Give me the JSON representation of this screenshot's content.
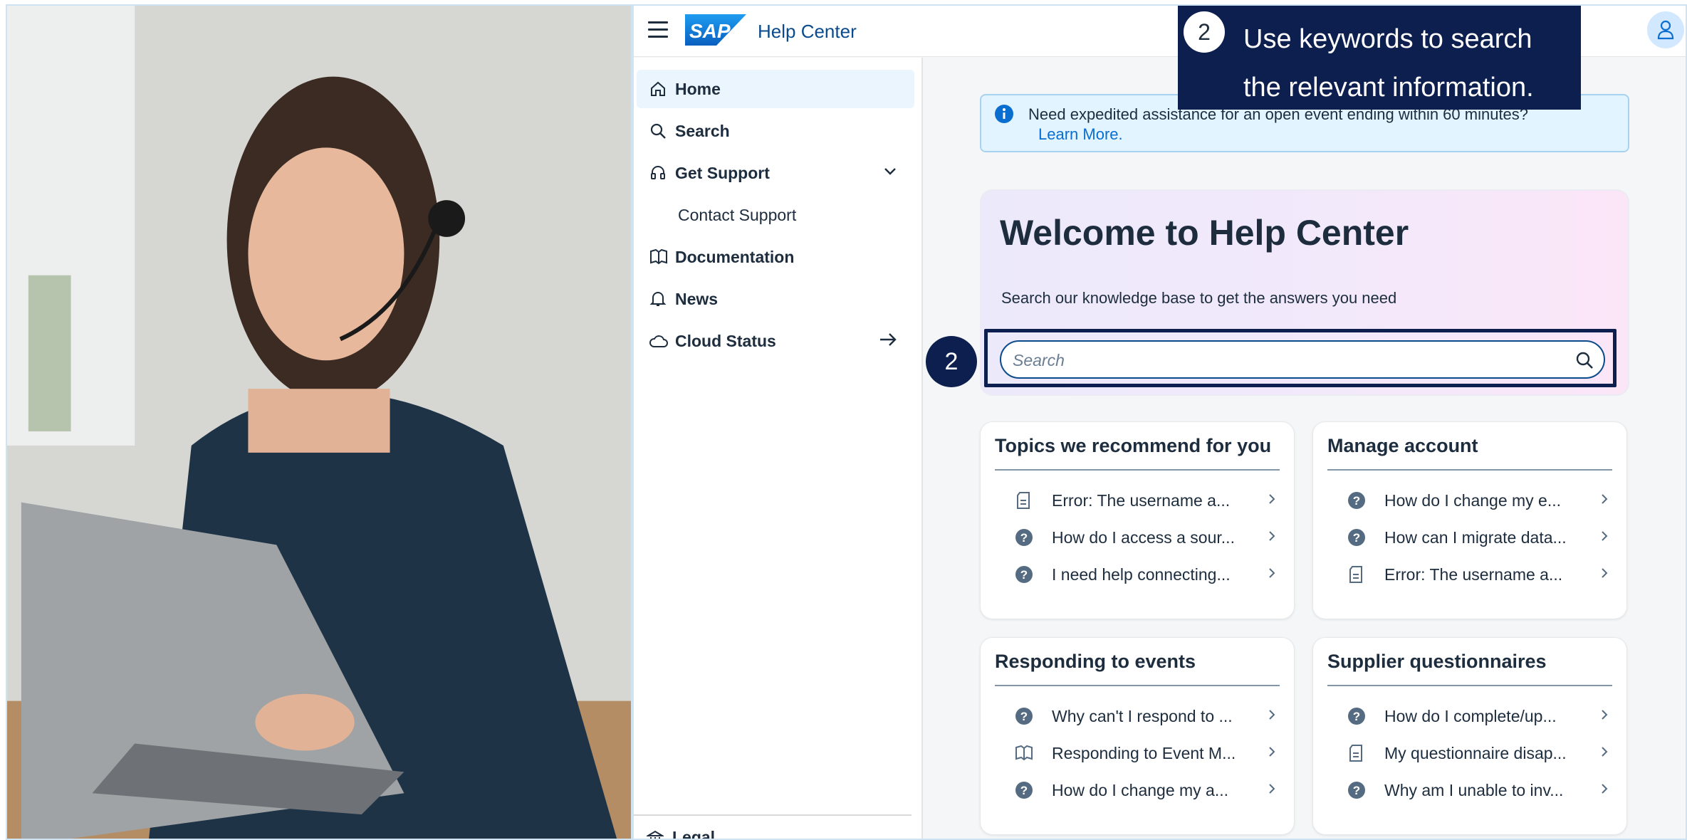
{
  "app": {
    "brand_logo_text": "SAP",
    "title": "Help Center"
  },
  "sidebar": {
    "items": [
      {
        "label": "Home",
        "icon": "home-icon",
        "active": true
      },
      {
        "label": "Search",
        "icon": "search-icon"
      },
      {
        "label": "Get Support",
        "icon": "headset-icon",
        "expanded": true
      },
      {
        "label": "Documentation",
        "icon": "book-icon"
      },
      {
        "label": "News",
        "icon": "bell-icon"
      },
      {
        "label": "Cloud Status",
        "icon": "cloud-icon"
      }
    ],
    "sub_items": [
      {
        "label": "Contact Support"
      }
    ],
    "footer": {
      "label": "Legal",
      "icon": "institution-icon"
    }
  },
  "banner": {
    "text": "Need expedited assistance for an open event ending within 60 minutes?",
    "link": "Learn More."
  },
  "welcome": {
    "title": "Welcome to Help Center",
    "subtitle": "Search our knowledge base to get the answers you need",
    "search_placeholder": "Search"
  },
  "callout": {
    "step": "2",
    "line1": "Use keywords to search",
    "line2": "the relevant information."
  },
  "step_badge": "2",
  "cards": [
    {
      "title": "Topics we recommend for you",
      "items": [
        {
          "text": "Error: The username a...",
          "icon": "document-icon"
        },
        {
          "text": "How do I access a sour...",
          "icon": "question-icon"
        },
        {
          "text": "I need help connecting...",
          "icon": "question-icon"
        }
      ]
    },
    {
      "title": "Manage account",
      "items": [
        {
          "text": "How do I change my e...",
          "icon": "question-icon"
        },
        {
          "text": "How can I migrate data...",
          "icon": "question-icon"
        },
        {
          "text": "Error: The username a...",
          "icon": "document-icon"
        }
      ]
    },
    {
      "title": "Responding to events",
      "items": [
        {
          "text": "Why can't I respond to ...",
          "icon": "question-icon"
        },
        {
          "text": "Responding to Event M...",
          "icon": "book-icon"
        },
        {
          "text": "How do I change my a...",
          "icon": "question-icon"
        }
      ]
    },
    {
      "title": "Supplier questionnaires",
      "items": [
        {
          "text": "How do I complete/up...",
          "icon": "question-icon"
        },
        {
          "text": "My questionnaire disap...",
          "icon": "document-icon"
        },
        {
          "text": "Why am I unable to inv...",
          "icon": "question-icon"
        }
      ]
    }
  ],
  "colors": {
    "brand_blue": "#0a4b8c",
    "callout_navy": "#0d1f4f",
    "link_blue": "#0a6ed1"
  }
}
